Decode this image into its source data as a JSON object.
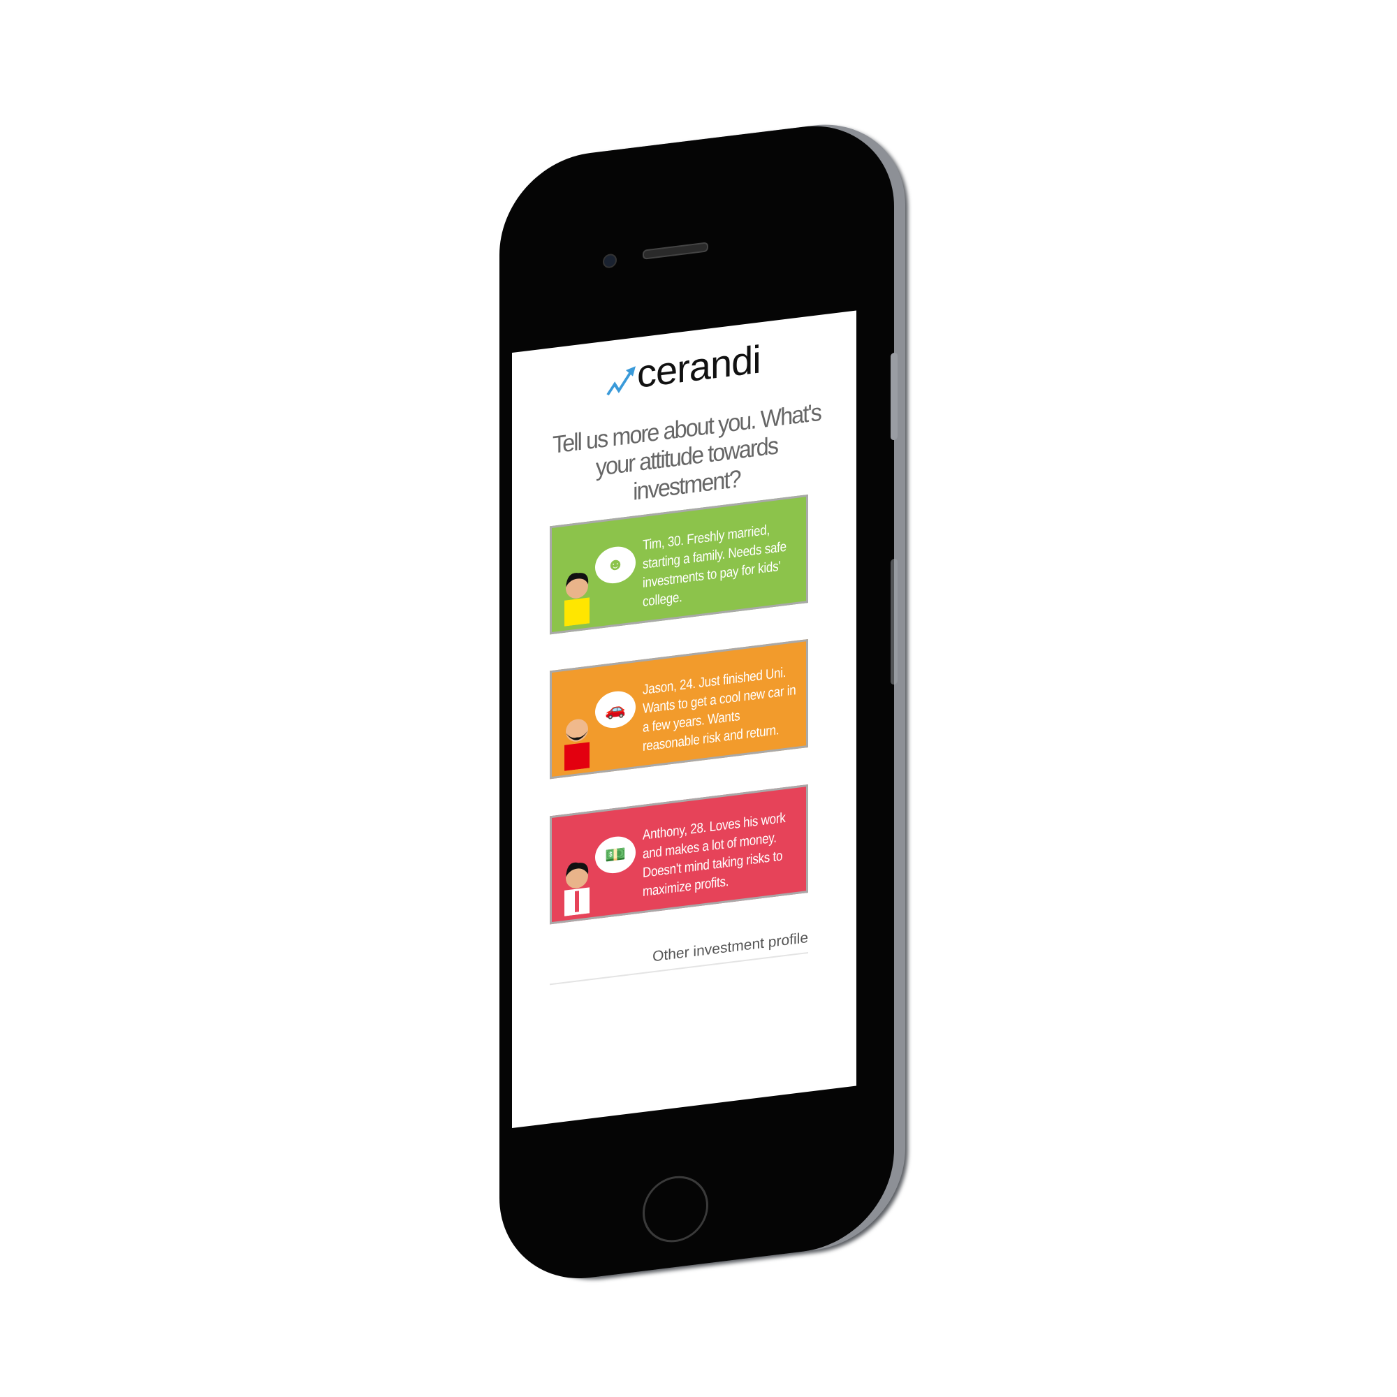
{
  "app": {
    "logo_text": "cerandi",
    "logo_icon": "trend-up-arrow-icon",
    "accent": "#3a9ad9"
  },
  "heading": "Tell us more about you. What's your attitude towards investment?",
  "profiles": [
    {
      "text": "Tim, 30. Freshly married, starting a family. Needs safe investments to pay for kids' college.",
      "color": "#8cc34b",
      "thought_icon": "baby-icon"
    },
    {
      "text": "Jason, 24. Just finished Uni. Wants to get a cool new car in a few years. Wants reasonable risk and return.",
      "color": "#f29b2c",
      "thought_icon": "car-icon"
    },
    {
      "text": "Anthony, 28. Loves his work and makes a lot of money. Doesn't mind taking risks to maximize profits.",
      "color": "#e64359",
      "thought_icon": "money-icon"
    }
  ],
  "other_link": "Other investment profile"
}
